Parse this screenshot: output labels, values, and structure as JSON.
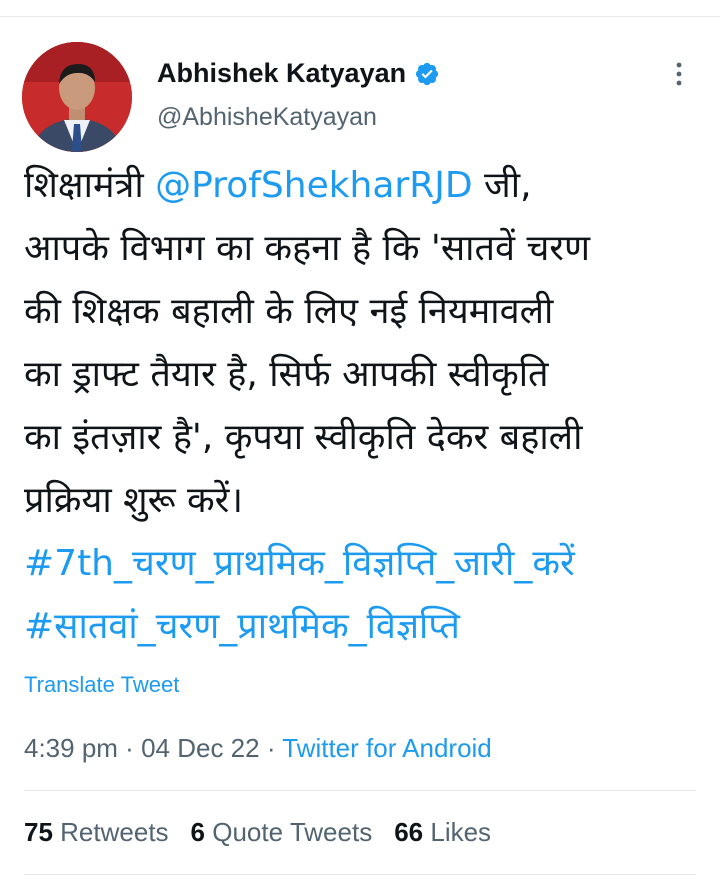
{
  "author": {
    "name": "Abhishek Katyayan",
    "handle": "@AbhisheKatyayan",
    "verified_icon": "verified-badge-icon",
    "badge_color": "#1d9bf0"
  },
  "tweet": {
    "lines": [
      {
        "pre": "शिक्षामंत्री ",
        "mention": "@ProfShekharRJD",
        "post": " जी,"
      },
      {
        "text": "आपके विभाग का कहना है कि 'सातवें चरण"
      },
      {
        "text": "की शिक्षक बहाली के लिए नई नियमावली"
      },
      {
        "text": "का ड्राफ्ट तैयार है, सिर्फ आपकी स्वीकृति"
      },
      {
        "text": "का इंतज़ार है', कृपया स्वीकृति देकर बहाली"
      },
      {
        "text": "प्रक्रिया शुरू करें।"
      }
    ],
    "hashtags": [
      "#7th_चरण_प्राथमिक_विज्ञप्ति_जारी_करें",
      "#सातवां_चरण_प्राथमिक_विज्ञप्ति"
    ]
  },
  "translate_label": "Translate Tweet",
  "meta": {
    "time": "4:39 pm",
    "separator": " · ",
    "date": "04 Dec 22",
    "source": "Twitter for Android"
  },
  "stats": {
    "retweets_count": "75",
    "retweets_label": "Retweets",
    "quotes_count": "6",
    "quotes_label": "Quote Tweets",
    "likes_count": "66",
    "likes_label": "Likes"
  },
  "colors": {
    "link": "#1d9bf0",
    "secondary_text": "#536471",
    "primary_text": "#0f1419"
  }
}
